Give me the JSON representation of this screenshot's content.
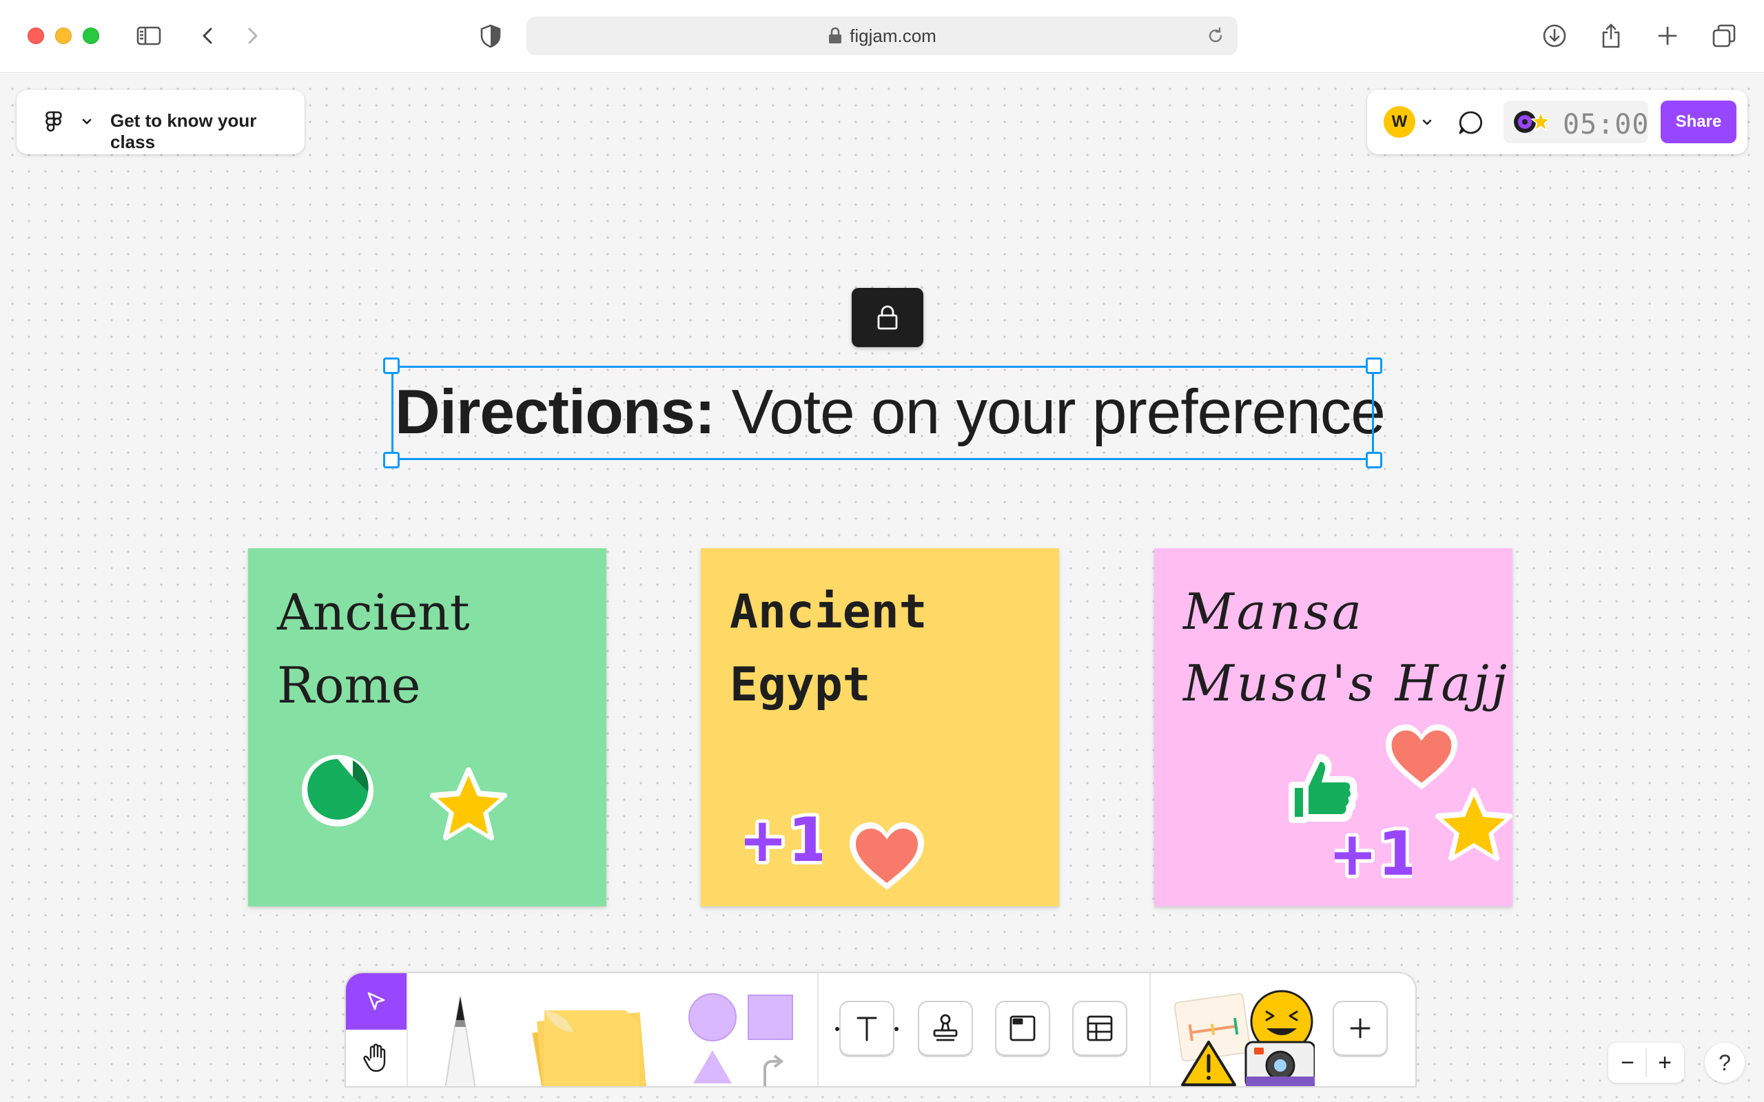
{
  "browser": {
    "url": "figjam.com"
  },
  "file": {
    "name": "Get to know your class"
  },
  "header": {
    "avatar_initial": "W",
    "timer": "05:00",
    "share_label": "Share"
  },
  "heading": {
    "bold": "Directions:",
    "rest": " Vote on your preference"
  },
  "stickies": [
    {
      "line1": "Ancient",
      "line2": "Rome",
      "color": "#85e0a3"
    },
    {
      "line1": "Ancient",
      "line2": "Egypt",
      "color": "#ffd966"
    },
    {
      "line1": "Mansa",
      "line2": "Musa's Hajj",
      "color": "#ffbdf2"
    }
  ],
  "stickers": {
    "plus_one": "+1"
  },
  "toolbar": {
    "text_tool": "T"
  },
  "zoom": {
    "minus": "−",
    "plus": "+",
    "help": "?"
  },
  "colors": {
    "accent": "#9747ff",
    "selection": "#0d99ff"
  }
}
